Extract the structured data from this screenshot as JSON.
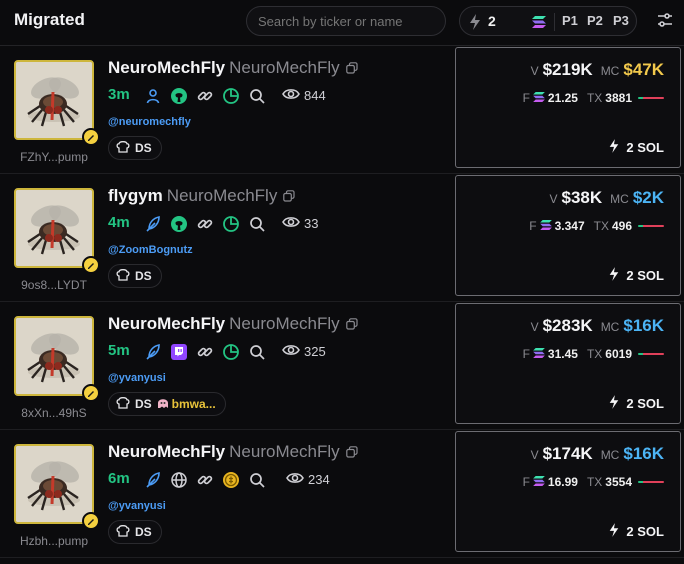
{
  "header": {
    "title": "Migrated",
    "search_placeholder": "Search by ticker or name",
    "quick_buy_amount": "2",
    "presets": [
      "P1",
      "P2",
      "P3"
    ]
  },
  "colors": {
    "accent_green": "#23c483",
    "mc_yellow": "#f2c94c",
    "mc_blue": "#4cb4f5",
    "handle_blue": "#4c9cf5"
  },
  "tokens": [
    {
      "name": "NeuroMechFly",
      "sub": "NeuroMechFly",
      "age": "3m",
      "social_icons": [
        "user-icon",
        "github-icon",
        "link-icon",
        "pie-icon",
        "search-icon"
      ],
      "views": "844",
      "handle": "@neuromechfly",
      "address": "FZhY...pump",
      "tag": "DS",
      "tag_extra": "",
      "volume_label": "V",
      "volume": "$219K",
      "mc_label": "MC",
      "mc": "$47K",
      "mc_color": "#f2c94c",
      "fees_label": "F",
      "fees": "21.25",
      "tx_label": "TX",
      "tx": "3881",
      "buy_label": "2 SOL"
    },
    {
      "name": "flygym",
      "sub": "NeuroMechFly",
      "age": "4m",
      "social_icons": [
        "feather-icon",
        "github-icon",
        "link-icon",
        "pie-icon",
        "search-icon"
      ],
      "views": "33",
      "handle": "@ZoomBognutz",
      "address": "9os8...LYDT",
      "tag": "DS",
      "tag_extra": "",
      "volume_label": "V",
      "volume": "$38K",
      "mc_label": "MC",
      "mc": "$2K",
      "mc_color": "#4cb4f5",
      "fees_label": "F",
      "fees": "3.347",
      "tx_label": "TX",
      "tx": "496",
      "buy_label": "2 SOL"
    },
    {
      "name": "NeuroMechFly",
      "sub": "NeuroMechFly",
      "age": "5m",
      "social_icons": [
        "feather-icon",
        "twitch-icon",
        "link-icon",
        "pie-icon",
        "search-icon"
      ],
      "views": "325",
      "handle": "@yvanyusi",
      "address": "8xXn...49hS",
      "tag": "DS",
      "tag_extra": "bmwa...",
      "volume_label": "V",
      "volume": "$283K",
      "mc_label": "MC",
      "mc": "$16K",
      "mc_color": "#4cb4f5",
      "fees_label": "F",
      "fees": "31.45",
      "tx_label": "TX",
      "tx": "6019",
      "buy_label": "2 SOL"
    },
    {
      "name": "NeuroMechFly",
      "sub": "NeuroMechFly",
      "age": "6m",
      "social_icons": [
        "feather-icon",
        "globe-icon",
        "link-icon",
        "coin-icon",
        "search-icon"
      ],
      "views": "234",
      "handle": "@yvanyusi",
      "address": "Hzbh...pump",
      "tag": "DS",
      "tag_extra": "",
      "volume_label": "V",
      "volume": "$174K",
      "mc_label": "MC",
      "mc": "$16K",
      "mc_color": "#4cb4f5",
      "fees_label": "F",
      "fees": "16.99",
      "tx_label": "TX",
      "tx": "3554",
      "buy_label": "2 SOL"
    }
  ]
}
